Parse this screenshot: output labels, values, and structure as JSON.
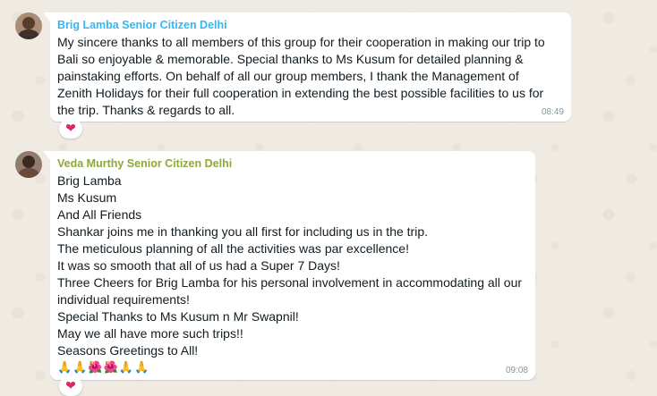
{
  "chat": {
    "messages": [
      {
        "sender": "Brig Lamba Senior Citizen Delhi",
        "sender_color": "#34b7f1",
        "lines": [
          "My sincere thanks to all members of this group for their cooperation in making our trip to",
          "Bali so enjoyable & memorable. Special thanks to Ms Kusum for detailed planning &",
          "painstaking efforts. On behalf of all our group members, I thank the Management of",
          "Zenith Holidays for their full cooperation in extending the best possible facilities to us for",
          "the trip. Thanks & regards to all."
        ],
        "time": "08:49",
        "reaction": "❤"
      },
      {
        "sender": "Veda Murthy Senior Citizen Delhi",
        "sender_color": "#8fa83a",
        "lines": [
          "Brig Lamba",
          "Ms Kusum",
          "And All Friends",
          "Shankar joins me in thanking you all first for including us in the trip.",
          "The meticulous planning of all the activities was par excellence!",
          "It was so smooth that all of us had a Super 7 Days!",
          "Three Cheers for Brig Lamba for his personal involvement in accommodating all our",
          "individual requirements!",
          "Special Thanks to Ms Kusum n Mr Swapnil!",
          "May we all have more such trips!!",
          "Seasons Greetings to All!"
        ],
        "emojis": [
          "🙏",
          "🙏",
          "🌺",
          "🌺",
          "🙏",
          "🙏"
        ],
        "time": "09:08",
        "reaction": "❤"
      }
    ]
  }
}
